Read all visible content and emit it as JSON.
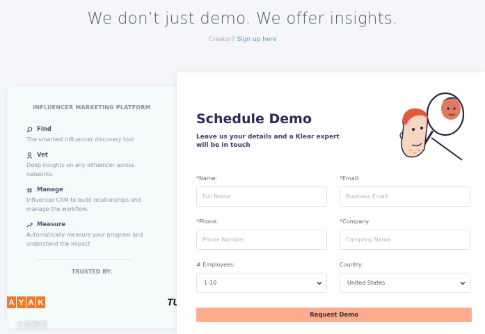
{
  "header": {
    "headline": "We don’t just demo. We offer insights.",
    "creator_prefix": "Creator?",
    "creator_link": "Sign up here"
  },
  "left_panel": {
    "title": "INFLUENCER MARKETING PLATFORM",
    "features": [
      {
        "icon": "search-icon",
        "title": "Find",
        "desc": "The smartest influencer discovery tool"
      },
      {
        "icon": "person-icon",
        "title": "Vet",
        "desc": "Deep insights on any influencer across networks."
      },
      {
        "icon": "hashtag-icon",
        "title": "Manage",
        "desc": "Influencer CRM to build relationships and manage the workflow."
      },
      {
        "icon": "trend-icon",
        "title": "Measure",
        "desc": "Automatically measure your program and understand the impact"
      }
    ],
    "trusted_label": "TRUSTED BY:",
    "logos": [
      "AYAK",
      "TU"
    ]
  },
  "form": {
    "title": "Schedule Demo",
    "subtitle": "Leave us your details and a Klear expert will be in touch",
    "name_label": "*Name:",
    "name_placeholder": "Full Name",
    "email_label": "*Email:",
    "email_placeholder": "Business Email",
    "phone_label": "*Phone:",
    "phone_placeholder": "Phone Number",
    "company_label": "*Company:",
    "company_placeholder": "Company Name",
    "employees_label": "# Employees:",
    "employees_value": "1-10",
    "country_label": "Country:",
    "country_value": "United States",
    "submit_label": "Request Demo"
  },
  "watermark": "大数跨境",
  "colors": {
    "accent_button": "#fdad8e",
    "link": "#3aa3d9",
    "title": "#2d2b55",
    "kayak_orange": "#f17a2b"
  }
}
